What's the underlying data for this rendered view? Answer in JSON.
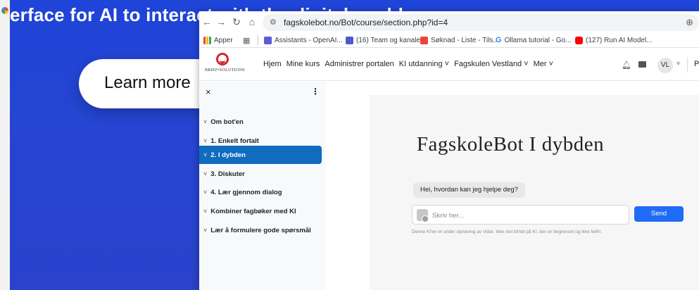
{
  "background_page": {
    "headline": "erface for AI to interact with the digital world",
    "button_label": "Learn more"
  },
  "browser": {
    "url": "fagskolebot.no/Bot/course/section.php?id=4",
    "bookmarks": [
      {
        "label": "Apper",
        "color": "#f4b400"
      },
      {
        "label": "Assistants - OpenAI...",
        "color": "#5f5bd6"
      },
      {
        "label": "(16) Team og kanale...",
        "color": "#5059c9"
      },
      {
        "label": "Søknad - Liste - Tils...",
        "color": "#e8453c"
      },
      {
        "label": "Ollama tutorial - Go...",
        "color": "#4285f4"
      },
      {
        "label": "(127) Run AI Model...",
        "color": "#ff0000"
      }
    ]
  },
  "site": {
    "logo_text": "BRIEF•SOLUTIONS",
    "menu": [
      "Hjem",
      "Mine kurs",
      "Administrer portalen",
      "KI utdanning ˅",
      "Fagskulen Vestland ˅",
      "Mer ˅"
    ],
    "avatar": "VL",
    "right_letter": "P"
  },
  "sidebar": {
    "items": [
      {
        "label": "Om bot'en",
        "active": false
      },
      {
        "label": "1. Enkelt fortalt",
        "active": false
      },
      {
        "label": "2. I dybden",
        "active": true
      },
      {
        "label": "3. Diskuter",
        "active": false
      },
      {
        "label": "4. Lær gjennom dialog",
        "active": false
      },
      {
        "label": "Kombiner fagbøker med KI",
        "active": false
      },
      {
        "label": "Lær å formulere gode spørsmål",
        "active": false
      }
    ]
  },
  "main": {
    "title": "FagskoleBot I dybden",
    "bot_message": "Hei, hvordan kan jeg hjelpe deg?",
    "input_placeholder": "Skriv her...",
    "send_label": "Send",
    "disclaimer": "Denne KI'en er under utprøving av Vidar. Ikke stol blindt på KI, den er begrenset og ikke feilfri."
  },
  "colors": {
    "brand_blue": "#0f6cbf",
    "send_blue": "#1f6cf6",
    "logo_red": "#d6262d"
  }
}
